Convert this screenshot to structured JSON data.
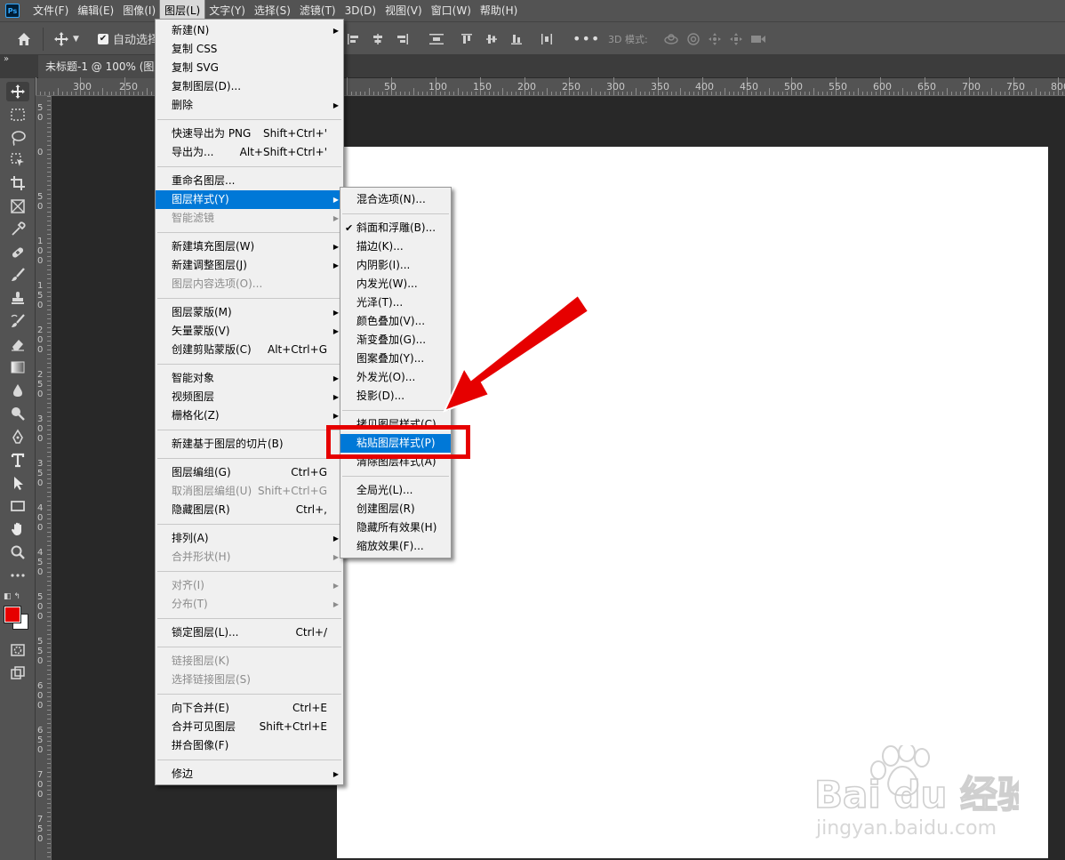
{
  "menubar": {
    "items": [
      "文件(F)",
      "编辑(E)",
      "图像(I)",
      "图层(L)",
      "文字(Y)",
      "选择(S)",
      "滤镜(T)",
      "3D(D)",
      "视图(V)",
      "窗口(W)",
      "帮助(H)"
    ],
    "app_logo": "Ps"
  },
  "optionsbar": {
    "auto_select": "自动选择",
    "mode_3d": "3D 模式:"
  },
  "document": {
    "tab_title": "未标题-1 @ 100% (图层"
  },
  "ruler_top": {
    "ticks": [
      "300",
      "250",
      "50",
      "100",
      "150",
      "200",
      "250",
      "300",
      "350",
      "400",
      "450",
      "500",
      "550",
      "600",
      "650",
      "700",
      "750",
      "800"
    ]
  },
  "ruler_left": {
    "ticks": [
      "5\n0",
      "0",
      "5\n0",
      "1\n0\n0",
      "1\n5\n0",
      "2\n0\n0",
      "2\n5\n0",
      "3\n0\n0",
      "3\n5\n0",
      "4\n0\n0",
      "4\n5\n0",
      "5\n0\n0",
      "5\n5\n0",
      "6\n0\n0",
      "6\n5\n0",
      "7\n0\n0",
      "7\n5\n0"
    ]
  },
  "layer_menu": {
    "items": [
      {
        "label": "新建(N)",
        "submenu": true
      },
      {
        "label": "复制 CSS"
      },
      {
        "label": "复制 SVG"
      },
      {
        "label": "复制图层(D)..."
      },
      {
        "label": "删除",
        "submenu": true
      },
      {
        "sep": true
      },
      {
        "label": "快速导出为 PNG",
        "shortcut": "Shift+Ctrl+'"
      },
      {
        "label": "导出为...",
        "shortcut": "Alt+Shift+Ctrl+'"
      },
      {
        "sep": true
      },
      {
        "label": "重命名图层..."
      },
      {
        "label": "图层样式(Y)",
        "submenu": true,
        "highlight": true
      },
      {
        "label": "智能滤镜",
        "submenu": true,
        "disabled": true
      },
      {
        "sep": true
      },
      {
        "label": "新建填充图层(W)",
        "submenu": true
      },
      {
        "label": "新建调整图层(J)",
        "submenu": true
      },
      {
        "label": "图层内容选项(O)...",
        "disabled": true
      },
      {
        "sep": true
      },
      {
        "label": "图层蒙版(M)",
        "submenu": true
      },
      {
        "label": "矢量蒙版(V)",
        "submenu": true
      },
      {
        "label": "创建剪贴蒙版(C)",
        "shortcut": "Alt+Ctrl+G"
      },
      {
        "sep": true
      },
      {
        "label": "智能对象",
        "submenu": true
      },
      {
        "label": "视频图层",
        "submenu": true
      },
      {
        "label": "栅格化(Z)",
        "submenu": true
      },
      {
        "sep": true
      },
      {
        "label": "新建基于图层的切片(B)"
      },
      {
        "sep": true
      },
      {
        "label": "图层编组(G)",
        "shortcut": "Ctrl+G"
      },
      {
        "label": "取消图层编组(U)",
        "shortcut": "Shift+Ctrl+G",
        "disabled": true
      },
      {
        "label": "隐藏图层(R)",
        "shortcut": "Ctrl+,"
      },
      {
        "sep": true
      },
      {
        "label": "排列(A)",
        "submenu": true
      },
      {
        "label": "合并形状(H)",
        "submenu": true,
        "disabled": true
      },
      {
        "sep": true
      },
      {
        "label": "对齐(I)",
        "submenu": true,
        "disabled": true
      },
      {
        "label": "分布(T)",
        "submenu": true,
        "disabled": true
      },
      {
        "sep": true
      },
      {
        "label": "锁定图层(L)...",
        "shortcut": "Ctrl+/"
      },
      {
        "sep": true
      },
      {
        "label": "链接图层(K)",
        "disabled": true
      },
      {
        "label": "选择链接图层(S)",
        "disabled": true
      },
      {
        "sep": true
      },
      {
        "label": "向下合并(E)",
        "shortcut": "Ctrl+E"
      },
      {
        "label": "合并可见图层",
        "shortcut": "Shift+Ctrl+E"
      },
      {
        "label": "拼合图像(F)"
      },
      {
        "sep": true
      },
      {
        "label": "修边",
        "submenu": true
      }
    ]
  },
  "style_submenu": {
    "items": [
      {
        "label": "混合选项(N)..."
      },
      {
        "sep": true
      },
      {
        "label": "斜面和浮雕(B)...",
        "checked": true
      },
      {
        "label": "描边(K)..."
      },
      {
        "label": "内阴影(I)..."
      },
      {
        "label": "内发光(W)..."
      },
      {
        "label": "光泽(T)..."
      },
      {
        "label": "颜色叠加(V)..."
      },
      {
        "label": "渐变叠加(G)..."
      },
      {
        "label": "图案叠加(Y)..."
      },
      {
        "label": "外发光(O)..."
      },
      {
        "label": "投影(D)..."
      },
      {
        "sep": true
      },
      {
        "label": "拷贝图层样式(C)"
      },
      {
        "label": "粘贴图层样式(P)",
        "highlight": true
      },
      {
        "label": "清除图层样式(A)"
      },
      {
        "sep": true
      },
      {
        "label": "全局光(L)..."
      },
      {
        "label": "创建图层(R)"
      },
      {
        "label": "隐藏所有效果(H)"
      },
      {
        "label": "缩放效果(F)..."
      }
    ]
  },
  "watermark": {
    "brand": "Bai du 经验",
    "url": "jingyan.baidu.com"
  },
  "colors": {
    "highlight": "#0078d7",
    "annotation": "#e60000",
    "foreground": "#e60000",
    "background": "#ffffff"
  }
}
